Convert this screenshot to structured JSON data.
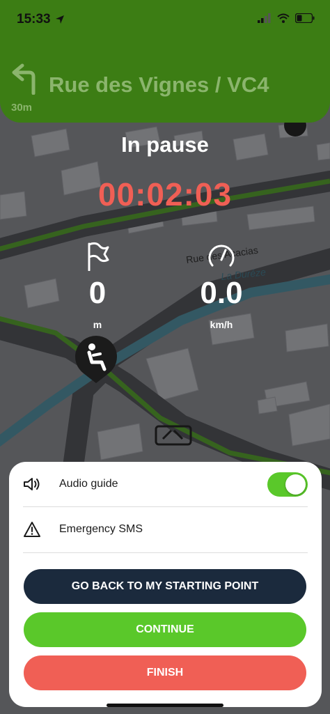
{
  "status_bar": {
    "time": "15:33",
    "location_icon": "location-arrow-icon",
    "signal_icon": "cellular-signal-icon",
    "wifi_icon": "wifi-icon",
    "battery_icon": "battery-low-icon"
  },
  "navigation": {
    "turn_icon": "turn-left-arrow-icon",
    "street": "Rue des Vignes / VC4",
    "distance": "30m"
  },
  "map": {
    "labels": [
      "Rue des Acacias",
      "La Duréze"
    ]
  },
  "pause": {
    "title": "In pause",
    "timer": "00:02:03"
  },
  "stats": {
    "distance": {
      "icon": "flag-icon",
      "value": "0",
      "unit": "m"
    },
    "speed": {
      "icon": "speedometer-icon",
      "value": "0.0",
      "unit": "km/h"
    }
  },
  "sheet": {
    "audio_guide": {
      "label": "Audio guide",
      "icon": "speaker-icon",
      "enabled": true
    },
    "emergency_sms": {
      "label": "Emergency SMS",
      "icon": "warning-triangle-icon"
    },
    "buttons": {
      "back": "GO BACK TO MY STARTING POINT",
      "continue": "CONTINUE",
      "finish": "FINISH"
    }
  },
  "colors": {
    "header_green": "#3c7d14",
    "timer_red": "#f05f55",
    "continue_green": "#5ac82a",
    "back_navy": "#1b2a3d",
    "finish_red": "#f05f55"
  }
}
